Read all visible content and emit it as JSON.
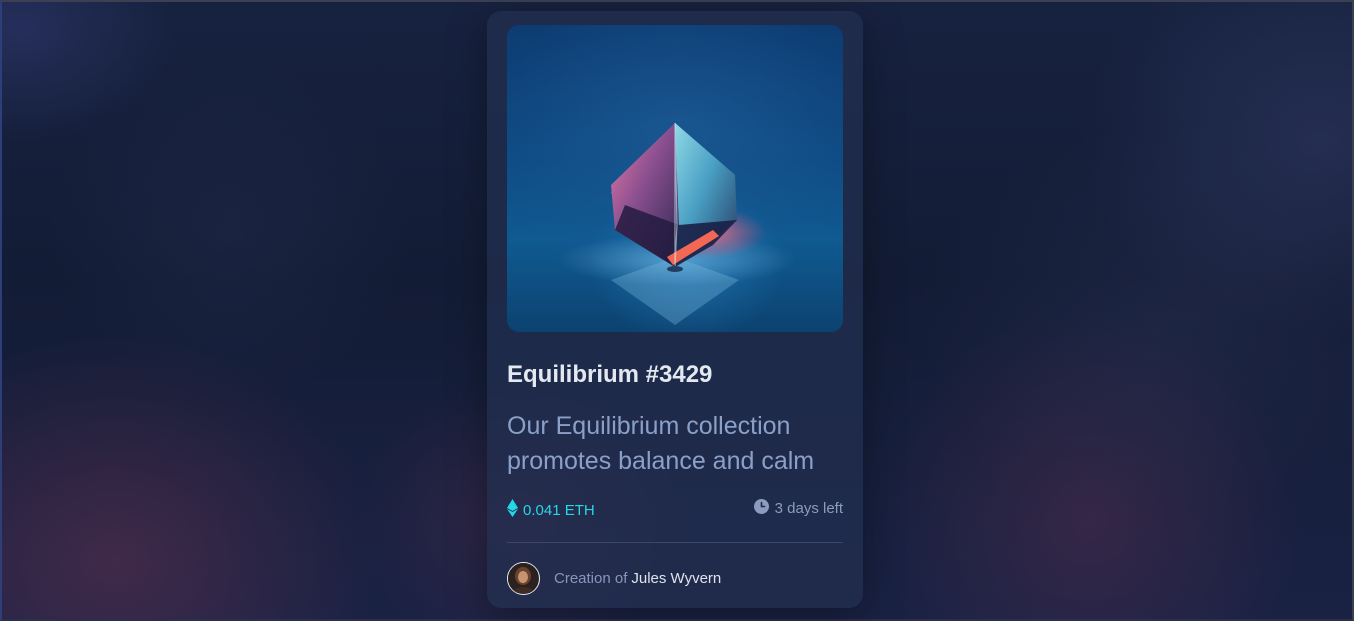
{
  "card": {
    "image": {
      "alt": "Equilibrium",
      "icon": "glass-cube"
    },
    "title": "Equilibrium #3429",
    "description": "Our Equilibrium collection promotes balance and calm",
    "price": {
      "icon": "ethereum-icon",
      "value": "0.041 ETH"
    },
    "time": {
      "icon": "clock-icon",
      "value": "3 days left"
    },
    "creator": {
      "prefix": "Creation of",
      "name": "Jules Wyvern",
      "avatar": "avatar"
    }
  },
  "colors": {
    "background": "#121c33",
    "card": "#1f2a47",
    "cyan": "#23d8e6",
    "muted": "#8aa0c9",
    "white": "#e4e8f0"
  }
}
